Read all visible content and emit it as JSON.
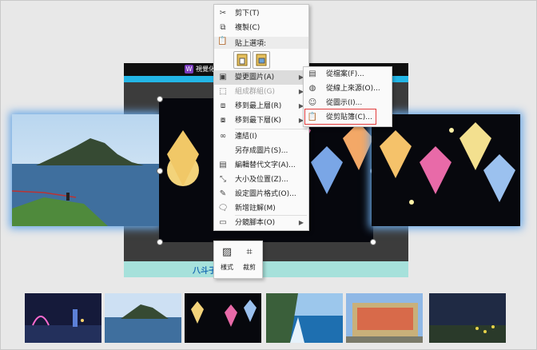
{
  "slide": {
    "header_logo": "W",
    "header_title": "視覺化",
    "footer_caption": "八斗子"
  },
  "context_menu": {
    "items": [
      {
        "icon": "scissors-icon",
        "label": "剪下(T)"
      },
      {
        "icon": "copy-icon",
        "label": "複製(C)"
      },
      {
        "icon": "paste-icon",
        "label": "貼上選項:"
      },
      {
        "icon": "change-picture-icon",
        "label": "變更圖片(A)",
        "arrow": "▶"
      },
      {
        "icon": "group-icon",
        "label": "組成群組(G)",
        "arrow": "▶"
      },
      {
        "icon": "bring-front-icon",
        "label": "移到最上層(R)",
        "arrow": "▶"
      },
      {
        "icon": "send-back-icon",
        "label": "移到最下層(K)",
        "arrow": "▶"
      },
      {
        "icon": "link-icon",
        "label": "連結(I)"
      },
      {
        "icon": "save-picture-icon",
        "label": "另存成圖片(S)..."
      },
      {
        "icon": "alt-text-icon",
        "label": "編輯替代文字(A)..."
      },
      {
        "icon": "size-position-icon",
        "label": "大小及位置(Z)..."
      },
      {
        "icon": "format-picture-icon",
        "label": "設定圖片格式(O)..."
      },
      {
        "icon": "new-comment-icon",
        "label": "新增註解(M)"
      },
      {
        "icon": "animation-script-icon",
        "label": "分鏡腳本(O)",
        "arrow": "▶"
      }
    ]
  },
  "submenu": {
    "items": [
      {
        "icon": "from-file-icon",
        "label": "從檔案(F)..."
      },
      {
        "icon": "from-online-icon",
        "label": "從線上來源(O)..."
      },
      {
        "icon": "from-icons-icon",
        "label": "從圖示(I)..."
      },
      {
        "icon": "from-clipboard-icon",
        "label": "從剪貼簿(C)..."
      }
    ]
  },
  "toolbar": {
    "style_label": "樣式",
    "crop_label": "裁剪"
  },
  "colors": {
    "highlight": "#dcdcdc",
    "annotation_red": "#e23b3b",
    "slide_cyan": "#23b6e6",
    "slide_footer": "#a6e1db"
  }
}
